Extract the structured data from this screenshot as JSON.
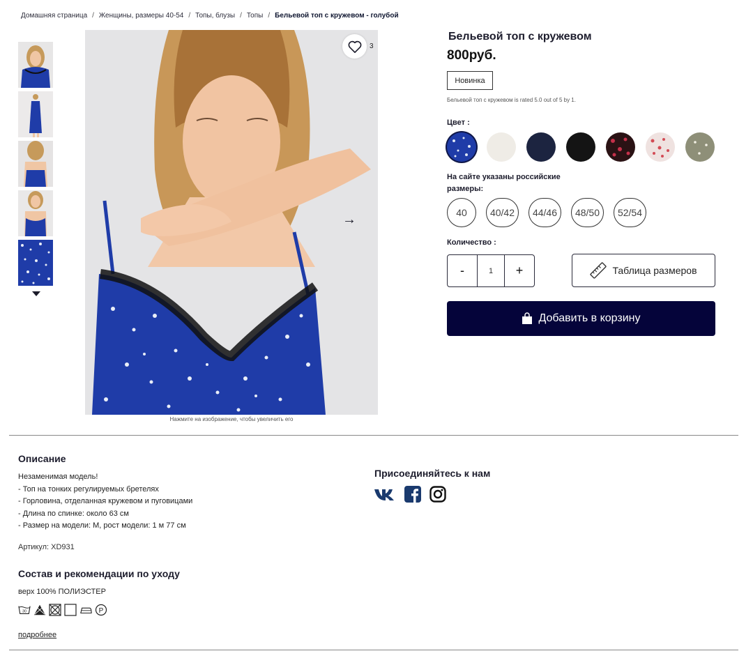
{
  "breadcrumb": {
    "items": [
      "Домашняя страница",
      "Женщины, размеры 40-54",
      "Топы, блузы",
      "Топы"
    ],
    "current": "Бельевой топ с кружевом - голубой",
    "separator": "/"
  },
  "gallery": {
    "favorite_count": "3",
    "zoom_hint": "Нажмите на изображение, чтобы увеличить его",
    "thumbnail_count": 5
  },
  "product": {
    "title": "Бельевой топ с кружевом",
    "price": "800руб.",
    "badge": "Новинка",
    "rating_text": "Бельевой топ с кружевом is rated 5.0 out of 5 by 1."
  },
  "color": {
    "label": "Цвет :",
    "swatches": [
      "#1f3ca8",
      "#efece6",
      "#1c2440",
      "#141414",
      "#2a1214",
      "#efe2e0",
      "#8e8f78"
    ]
  },
  "sizes": {
    "label": "На сайте указаны российские размеры:",
    "options": [
      "40",
      "40/42",
      "44/46",
      "48/50",
      "52/54"
    ]
  },
  "quantity": {
    "label": "Количество :",
    "minus": "-",
    "value": "1",
    "plus": "+"
  },
  "size_table_label": "Таблица размеров",
  "cart_label": "Добавить в корзину",
  "description": {
    "heading": "Описание",
    "lines": [
      "Незаменимая модель!",
      "- Топ на тонких регулируемых бретелях",
      "- Горловина, отделанная кружевом и пуговицами",
      "- Длина по спинке: около 63 см",
      "- Размер на модели: M, рост модели: 1 м 77 см"
    ],
    "article": "Артикул: XD931"
  },
  "care": {
    "heading": "Состав и рекомендации по уходу",
    "material": "верх 100% ПОЛИЭСТЕР",
    "wash_temp": "30",
    "more_link": "подробнее"
  },
  "social": {
    "heading": "Присоединяйтесь к нам"
  },
  "colors": {
    "accent": "#05043a",
    "print_blue": "#1f3ca8"
  }
}
